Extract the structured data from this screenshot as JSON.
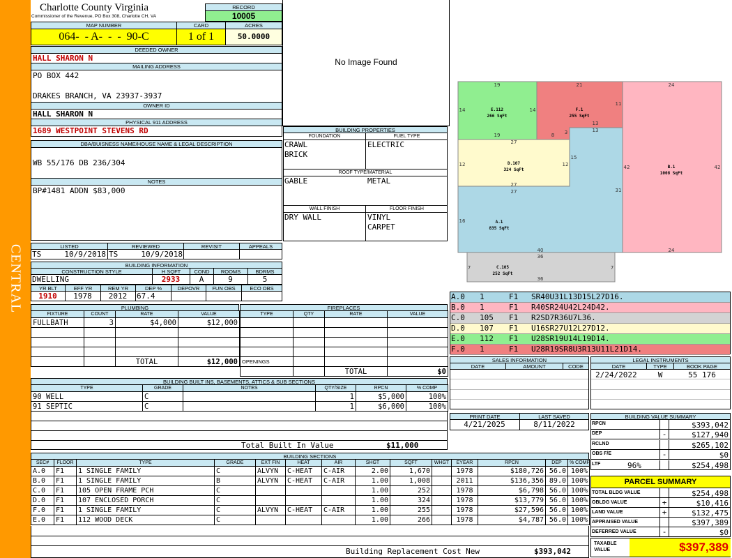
{
  "sidebar": {
    "label": "CENTRAL",
    "color": "#ff9900"
  },
  "header": {
    "county": "Charlotte County Virginia",
    "commissioner": "Commissioner of the Revenue, PO Box 308, Charlotte CH, VA"
  },
  "record": {
    "label": "RECORD",
    "value": "10005"
  },
  "map": {
    "label": "MAP NUMBER",
    "value": "064-  - A-  -  -  90-C"
  },
  "card": {
    "label": "CARD",
    "value": "1 of 1"
  },
  "acres": {
    "label": "ACRES",
    "value": "50.0000"
  },
  "deeded_owner": {
    "label": "DEEDED OWNER",
    "value": "HALL SHARON N"
  },
  "mailing": {
    "label": "MAILING ADDRESS",
    "line1": "PO BOX 442",
    "line2": "DRAKES BRANCH, VA 23937-3937"
  },
  "owner_id": {
    "label": "OWNER ID",
    "value": "HALL SHARON N"
  },
  "physical": {
    "label": "PHYSICAL 911 ADDRESS",
    "value": "1689 WESTPOINT STEVENS RD"
  },
  "legal": {
    "label": "DBA/BUISNESS NAME/HOUSE NAME & LEGAL DESCRIPTION",
    "value": "WB 55/176 DB 236/304"
  },
  "notes": {
    "label": "NOTES",
    "value": "BP#1481 ADDN $83,000"
  },
  "image": {
    "text": "No Image Found"
  },
  "building_props": {
    "title": "BUILDING PROPERTIES",
    "foundation_label": "FOUNDATION",
    "fuel_label": "FUEL TYPE",
    "foundation1": "CRAWL",
    "foundation2": "BRICK",
    "fuel": "ELECTRIC",
    "roof_label": "ROOF TYPE/MATERIAL",
    "roof_type": "GABLE",
    "roof_material": "METAL",
    "wall_label": "WALL FINISH",
    "floor_label": "FLOOR FINISH",
    "wall": "DRY WALL",
    "floor1": "VINYL",
    "floor2": "CARPET"
  },
  "review": {
    "listed_label": "LISTED",
    "reviewed_label": "REVIEWED",
    "revisit_label": "REVISIT",
    "appeals_label": "APPEALS",
    "listed_by": "TS",
    "listed_date": "10/9/2018",
    "reviewed_by": "TS",
    "reviewed_date": "10/9/2018"
  },
  "building_info": {
    "title": "BUILDING INFORMATION",
    "style_label": "CONSTRUCTION STYLE",
    "hsqft_label": "H SQFT",
    "cond_label": "COND",
    "rooms_label": "ROOMS",
    "bdrms_label": "BDRMS",
    "style": "DWELLING",
    "hsqft": "2933",
    "cond": "A",
    "rooms": "9",
    "bdrms": "5",
    "yrblt_label": "YR BLT",
    "effyr_label": "EFF YR",
    "remyr_label": "REM YR",
    "dep_label": "DEP %",
    "depovr_label": "DEPOVR",
    "funobs_label": "FUN OBS",
    "ecoobs_label": "ECO OBS",
    "yrblt": "1910",
    "effyr": "1978",
    "remyr": "2012",
    "dep": "67.4"
  },
  "plumbing": {
    "title": "PLUMBING",
    "headers": [
      "FIXTURE",
      "COUNT",
      "RATE",
      "VALUE"
    ],
    "rows": [
      [
        "FULLBATH",
        "3",
        "$4,000",
        "$12,000"
      ]
    ],
    "total_label": "TOTAL",
    "total": "$12,000"
  },
  "fireplaces": {
    "title": "FIREPLACES",
    "headers": [
      "TYPE",
      "QTY",
      "RATE",
      "VALUE"
    ],
    "openings_label": "OPENINGS",
    "total_label": "TOTAL",
    "total": "$0"
  },
  "sketch_labels": [
    {
      "id": "E.112",
      "sqft": "266 SqFt"
    },
    {
      "id": "F.1",
      "sqft": "255 SqFt"
    },
    {
      "id": "B.1",
      "sqft": "1008 SqFt"
    },
    {
      "id": "D.107",
      "sqft": "324 SqFt"
    },
    {
      "id": "A.1",
      "sqft": "835 SqFt"
    },
    {
      "id": "C.105",
      "sqft": "252 SqFt"
    }
  ],
  "sketch_dims": [
    "19",
    "21",
    "24",
    "14",
    "14",
    "11",
    "13",
    "19",
    "8",
    "3",
    "13",
    "27",
    "15",
    "12",
    "12",
    "42",
    "42",
    "27",
    "27",
    "31",
    "16",
    "40",
    "24",
    "36",
    "7",
    "7",
    "36"
  ],
  "sketch_legend": [
    {
      "id": "A.0",
      "num": "1",
      "fl": "F1",
      "code": "SR40U31L13D15L27D16.",
      "color": "#add8e6"
    },
    {
      "id": "B.0",
      "num": "1",
      "fl": "F1",
      "code": "R40SR24U42L24D42.",
      "color": "#ffb6c1"
    },
    {
      "id": "C.0",
      "num": "105",
      "fl": "F1",
      "code": "R2SD7R36U7L36.",
      "color": "#d3d3d3"
    },
    {
      "id": "D.0",
      "num": "107",
      "fl": "F1",
      "code": "U16SR27U12L27D12.",
      "color": "#fffacd"
    },
    {
      "id": "E.0",
      "num": "112",
      "fl": "F1",
      "code": "U28SR19U14L19D14.",
      "color": "#90ee90"
    },
    {
      "id": "F.0",
      "num": "1",
      "fl": "F1",
      "code": "U28R19SR8U3R13U11L21D14.",
      "color": "#f08080"
    }
  ],
  "sales": {
    "title": "SALES INFORMATION",
    "headers": [
      "DATE",
      "AMOUNT",
      "CODE"
    ]
  },
  "legal_instruments": {
    "title": "LEGAL INSTRUMENTS",
    "headers": [
      "DATE",
      "TYPE",
      "BOOK PAGE"
    ],
    "rows": [
      [
        "2/24/2022",
        "W",
        "55 176"
      ]
    ]
  },
  "dates": {
    "print_label": "PRINT DATE",
    "saved_label": "LAST SAVED",
    "print": "4/21/2025",
    "saved": "8/11/2022"
  },
  "built_ins": {
    "title": "BUILDING BUILT INS, BASEMENTS, ATTICS & SUB SECTIONS",
    "headers": [
      "TYPE",
      "GRADE",
      "NOTES",
      "QTY/SIZE",
      "RPCN",
      "% COMP"
    ],
    "rows": [
      [
        "90 WELL",
        "C",
        "",
        "1",
        "$5,000",
        "100%"
      ],
      [
        "91 SEPTIC",
        "C",
        "",
        "1",
        "$6,000",
        "100%"
      ]
    ],
    "total_label": "Total Built In Value",
    "total": "$11,000"
  },
  "sections": {
    "title": "BUILDING SECTIONS",
    "headers": [
      "SEC#",
      "FLOOR",
      "TYPE",
      "GRADE",
      "EXT FIN",
      "HEAT",
      "AIR",
      "SHGT",
      "SQFT",
      "WHGT",
      "EYEAR",
      "RPCN",
      "DEP",
      "% COMP"
    ],
    "rows": [
      [
        "A.0",
        "F1",
        "1 SINGLE FAMILY",
        "C",
        "ALVYN",
        "C-HEAT",
        "C-AIR",
        "2.00",
        "1,670",
        "",
        "1978",
        "$180,726",
        "56.0",
        "100%"
      ],
      [
        "B.0",
        "F1",
        "1 SINGLE FAMILY",
        "B",
        "ALVYN",
        "C-HEAT",
        "C-AIR",
        "1.00",
        "1,008",
        "",
        "2011",
        "$136,356",
        "89.0",
        "100%"
      ],
      [
        "C.0",
        "F1",
        "105 OPEN FRAME PCH",
        "C",
        "",
        "",
        "",
        "1.00",
        "252",
        "",
        "1978",
        "$6,798",
        "56.0",
        "100%"
      ],
      [
        "D.0",
        "F1",
        "107 ENCLOSED PORCH",
        "C",
        "",
        "",
        "",
        "1.00",
        "324",
        "",
        "1978",
        "$13,779",
        "56.0",
        "100%"
      ],
      [
        "F.0",
        "F1",
        "1 SINGLE FAMILY",
        "C",
        "ALVYN",
        "C-HEAT",
        "C-AIR",
        "1.00",
        "255",
        "",
        "1978",
        "$27,596",
        "56.0",
        "100%"
      ],
      [
        "E.0",
        "F1",
        "112 WOOD DECK",
        "C",
        "",
        "",
        "",
        "1.00",
        "266",
        "",
        "1978",
        "$4,787",
        "56.0",
        "100%"
      ]
    ],
    "total_label": "Building Replacement Cost New",
    "total": "$393,042"
  },
  "value_summary": {
    "title": "BUILDING VALUE SUMMARY",
    "rows": [
      {
        "label": "RPCN",
        "sign": "",
        "pct": "",
        "value": "$393,042"
      },
      {
        "label": "DEP",
        "sign": "-",
        "pct": "",
        "value": "$127,940"
      },
      {
        "label": "RCLND",
        "sign": "",
        "pct": "",
        "value": "$265,102"
      },
      {
        "label": "OBS F/E",
        "sign": "-",
        "pct": "",
        "value": "$0"
      },
      {
        "label": "LTF",
        "sign": "",
        "pct": "96%",
        "value": "$254,498"
      }
    ]
  },
  "parcel": {
    "title": "PARCEL SUMMARY",
    "rows": [
      {
        "label": "TOTAL BLDG VALUE",
        "sign": "",
        "value": "$254,498"
      },
      {
        "label": "OBLDG VALUE",
        "sign": "+",
        "value": "$10,416"
      },
      {
        "label": "LAND VALUE",
        "sign": "+",
        "value": "$132,475"
      },
      {
        "label": "APPRAISED VALUE",
        "sign": "",
        "value": "$397,389"
      },
      {
        "label": "DEFERRED VALUE",
        "sign": "-",
        "value": "$0"
      }
    ],
    "taxable_label": "TAXABLE VALUE",
    "taxable": "$397,389"
  }
}
